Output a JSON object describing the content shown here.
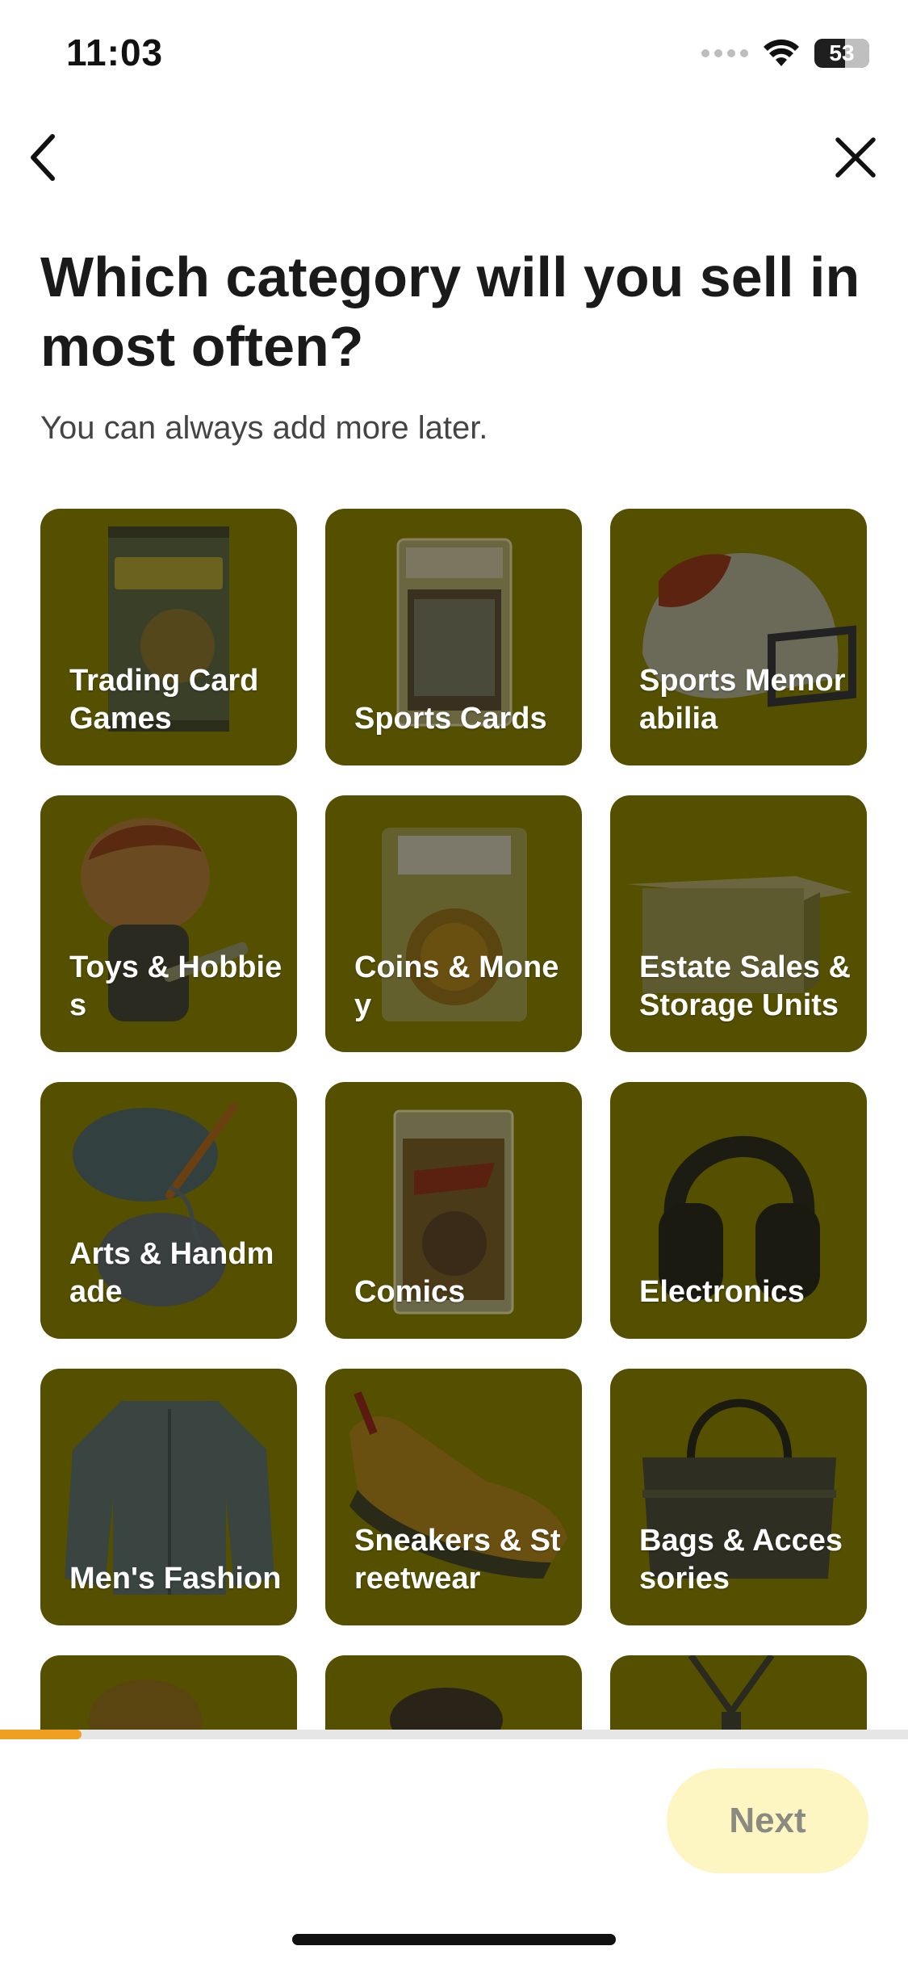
{
  "status_bar": {
    "time": "11:03",
    "battery": "53"
  },
  "header": {
    "title": "Which category will you sell in most often?",
    "subtitle": "You can always add more later."
  },
  "categories": [
    {
      "label": "Trading Card Games",
      "icon": "card-pack-icon"
    },
    {
      "label": "Sports Cards",
      "icon": "graded-card-icon"
    },
    {
      "label": "Sports Memorabilia",
      "icon": "football-helmet-icon"
    },
    {
      "label": "Toys & Hobbies",
      "icon": "vinyl-figure-icon"
    },
    {
      "label": "Coins & Money",
      "icon": "graded-coin-icon"
    },
    {
      "label": "Estate Sales & Storage Units",
      "icon": "cardboard-box-icon"
    },
    {
      "label": "Arts & Handmade",
      "icon": "yarn-icon"
    },
    {
      "label": "Comics",
      "icon": "comic-book-icon"
    },
    {
      "label": "Electronics",
      "icon": "headphones-icon"
    },
    {
      "label": "Men's Fashion",
      "icon": "jacket-icon"
    },
    {
      "label": "Sneakers & Streetwear",
      "icon": "sneaker-icon"
    },
    {
      "label": "Bags & Accessories",
      "icon": "handbag-icon"
    },
    {
      "label": "",
      "icon": "sweater-icon"
    },
    {
      "label": "",
      "icon": "makeup-brush-icon"
    },
    {
      "label": "",
      "icon": "necklace-icon"
    }
  ],
  "progress": {
    "fraction": 0.09
  },
  "footer": {
    "next_label": "Next"
  },
  "colors": {
    "tile_background": "#545000",
    "progress_fill": "#f0a020",
    "next_button_bg": "#fdf6c3",
    "next_button_text": "#8a8a80"
  }
}
